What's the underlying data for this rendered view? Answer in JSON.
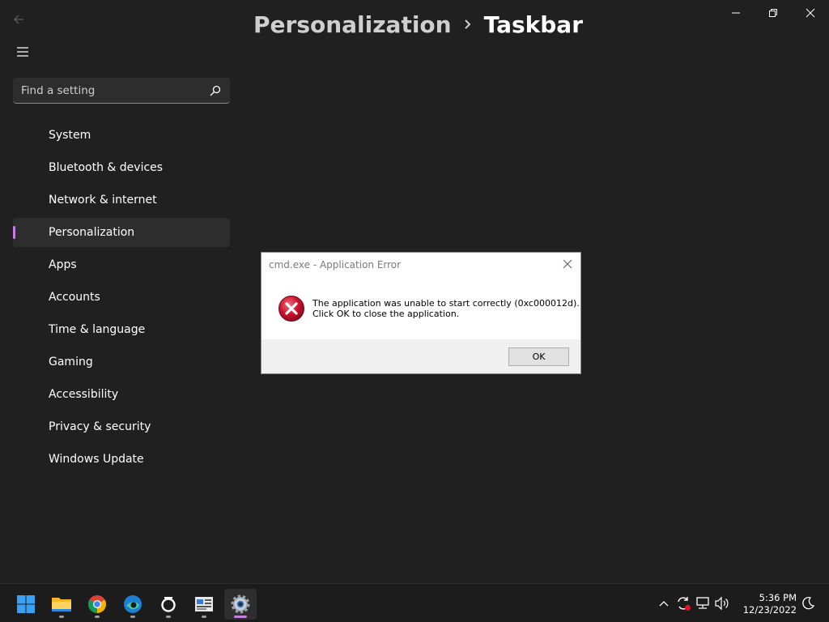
{
  "window": {
    "back_icon": "back-arrow-icon",
    "controls": [
      "minimize-icon",
      "restore-icon",
      "close-icon"
    ]
  },
  "header": {
    "parent": "Personalization",
    "current": "Taskbar"
  },
  "search": {
    "placeholder": "Find a setting"
  },
  "sidebar": {
    "items": [
      {
        "label": "System"
      },
      {
        "label": "Bluetooth & devices"
      },
      {
        "label": "Network & internet"
      },
      {
        "label": "Personalization",
        "active": true
      },
      {
        "label": "Apps"
      },
      {
        "label": "Accounts"
      },
      {
        "label": "Time & language"
      },
      {
        "label": "Gaming"
      },
      {
        "label": "Accessibility"
      },
      {
        "label": "Privacy & security"
      },
      {
        "label": "Windows Update"
      }
    ]
  },
  "dialog": {
    "title": "cmd.exe - Application Error",
    "message_line1": "The application was unable to start correctly (0xc000012d).",
    "message_line2": "Click OK to close the application.",
    "ok_label": "OK",
    "icon": "error-icon"
  },
  "taskbar": {
    "apps": [
      "start-icon",
      "file-explorer-icon",
      "chrome-icon",
      "edge-icon",
      "cortana-icon",
      "news-icon",
      "settings-icon"
    ],
    "active_app": "settings-icon",
    "tray": [
      "chevron-up-icon",
      "sync-icon",
      "network-icon",
      "volume-icon"
    ],
    "time": "5:36 PM",
    "date": "12/23/2022",
    "colors": {
      "accent": "#c57ee0",
      "background": "#202020"
    }
  }
}
